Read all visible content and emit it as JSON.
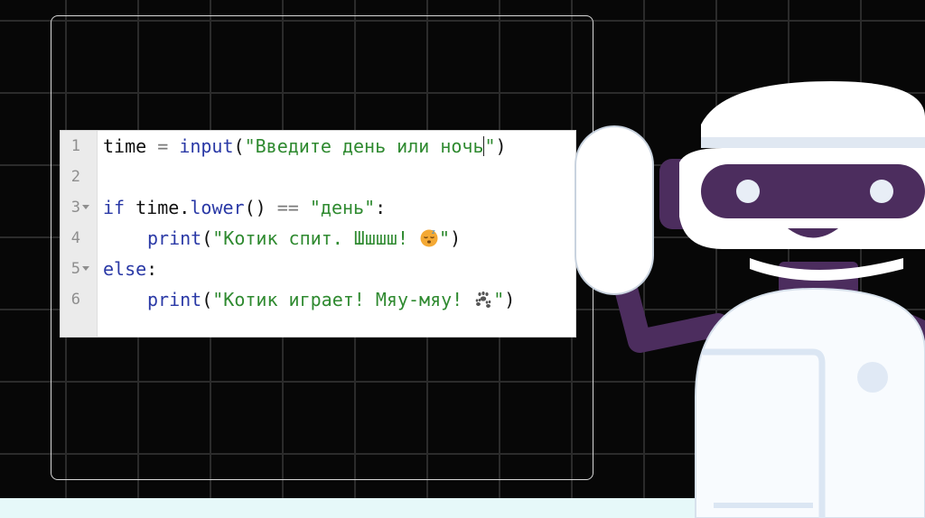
{
  "editor": {
    "line_numbers": [
      "1",
      "2",
      "3",
      "4",
      "5",
      "6"
    ],
    "code": {
      "l1": {
        "var": "time",
        "op": "=",
        "fn": "input",
        "open": "(",
        "arg": "\"Введите день или ночь",
        "close_quote": "\"",
        "close": ")"
      },
      "l3": {
        "if": "if",
        "expr": "time.",
        "method": "lower",
        "call": "()",
        "op": "==",
        "val": "\"день\"",
        "colon": ":"
      },
      "l4": {
        "fn": "print",
        "open": "(",
        "str_a": "\"Котик спит. Шшшш! ",
        "str_b": "\"",
        "close": ")"
      },
      "l5": {
        "else": "else",
        "colon": ":"
      },
      "l6": {
        "fn": "print",
        "open": "(",
        "str_a": "\"Котик играет! Мяу-мяу! ",
        "str_b": "\"",
        "close": ")"
      }
    },
    "icons": {
      "line4_emoji": "sleeping-face-icon",
      "line6_emoji": "paw-prints-icon"
    }
  },
  "colors": {
    "background": "#070707",
    "keyword": "#2a39a6",
    "string": "#2f8a30",
    "robot_accent": "#4c2d5e"
  }
}
